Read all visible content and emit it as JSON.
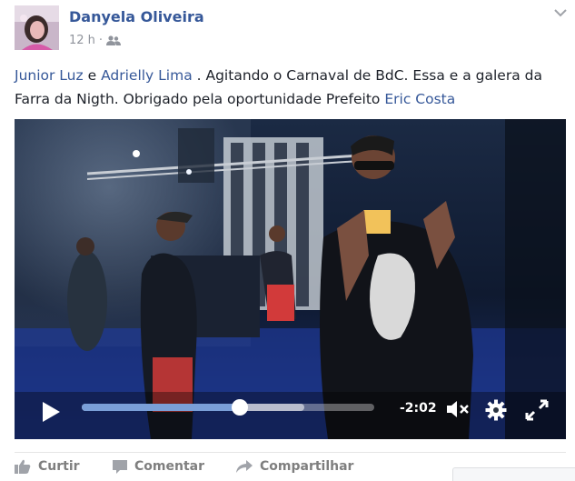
{
  "post": {
    "author": "Danyela Oliveira",
    "time": "12 h",
    "separator": "·",
    "audience_icon": "friends-icon",
    "menu_icon": "chevron-down-icon",
    "message": {
      "mention_1": "Junior Luz",
      "connector": "e",
      "mention_2": "Adrielly Lima",
      "body": ". Agitando o Carnaval de BdC. Essa e a galera da Farra da Nigth. Obrigado pela oportunidade Prefeito",
      "mention_3": "Eric Costa"
    }
  },
  "video": {
    "remaining_time": "-2:02",
    "progress_fraction": 0.54,
    "buffered_fraction": 0.76,
    "icons": [
      "play-icon",
      "mute-icon",
      "settings-icon",
      "fullscreen-icon"
    ]
  },
  "actions": {
    "like": "Curtir",
    "comment": "Comentar",
    "share": "Compartilhar"
  },
  "colors": {
    "link": "#365899",
    "progress": "#7a9fd8",
    "action_text": "#7f7f7f"
  }
}
